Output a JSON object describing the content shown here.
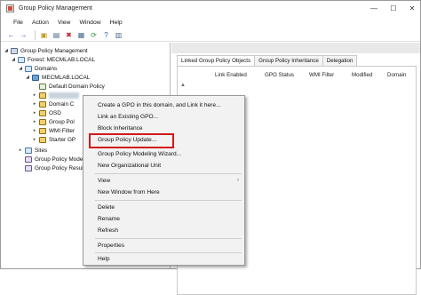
{
  "window": {
    "title": "Group Policy Management"
  },
  "window_controls": {
    "minimize": "—",
    "maximize": "☐",
    "close": "✕"
  },
  "menubar": {
    "items": [
      "File",
      "Action",
      "View",
      "Window",
      "Help"
    ]
  },
  "toolbar": {
    "buttons": [
      "back-icon",
      "forward-icon",
      "folder-icon",
      "console-icon",
      "delete-icon",
      "properties-icon",
      "refresh-icon",
      "help-icon",
      "view-icon"
    ],
    "glyphs": [
      "←",
      "→",
      "▣",
      "▤",
      "✖",
      "▦",
      "⟳",
      "?",
      "▥"
    ]
  },
  "tree": {
    "root": "Group Policy Management",
    "forest": "Forest: MECMLAB.LOCAL",
    "domains": "Domains",
    "domain": "MECMLAB.LOCAL",
    "default_policy": "Default Domain Policy",
    "domain_controllers": "Domain C",
    "osd": "OSD",
    "group_policy": "Group Pol",
    "wmi_filters": "WMI Filter",
    "starter_gpo": "Starter GP",
    "sites": "Sites",
    "modeling": "Group Policy Modeling",
    "results": "Group Policy Results"
  },
  "right": {
    "tabs": [
      "Linked Group Policy Objects",
      "Group Policy Inheritance",
      "Delegation"
    ],
    "columns": [
      "Link Enabled",
      "GPO Status",
      "WMI Filter",
      "Modified",
      "Domain"
    ]
  },
  "context_menu": {
    "items": [
      "Create a GPO in this domain, and Link it here...",
      "Link an Existing GPO...",
      "Block Inheritance",
      "Group Policy Update...",
      "Group Policy Modeling Wizard...",
      "New Organizational Unit",
      "View",
      "New Window from Here",
      "Delete",
      "Rename",
      "Refresh",
      "Properties",
      "Help"
    ],
    "submenu_arrow": "›",
    "highlight_color": "#d31a1a"
  }
}
